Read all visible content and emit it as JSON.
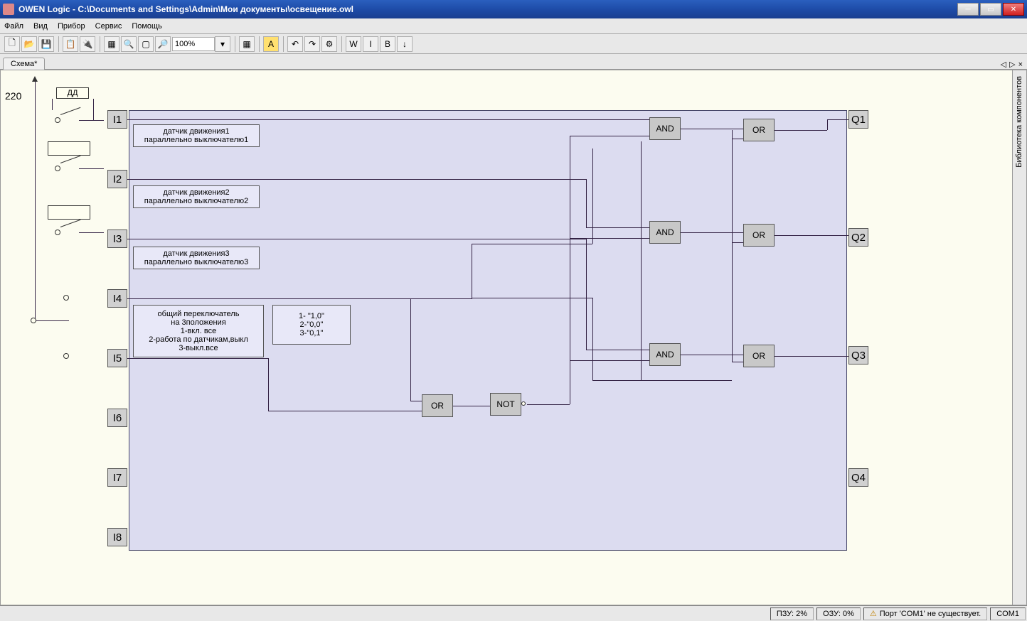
{
  "window": {
    "title": "OWEN Logic - C:\\Documents and Settings\\Admin\\Мои документы\\освещение.owl"
  },
  "menu": {
    "file": "Файл",
    "view": "Вид",
    "device": "Прибор",
    "service": "Сервис",
    "help": "Помощь"
  },
  "toolbar": {
    "zoom": "100%"
  },
  "tab": {
    "name": "Схема*"
  },
  "sidepanel": {
    "label": "Библиотека компонентов"
  },
  "status": {
    "rom": "ПЗУ: 2%",
    "ram": "ОЗУ: 0%",
    "port_msg": "Порт 'COM1' не существует.",
    "port": "COM1"
  },
  "diagram": {
    "voltage": "220",
    "dd": "ДД",
    "inputs": {
      "i1": "I1",
      "i2": "I2",
      "i3": "I3",
      "i4": "I4",
      "i5": "I5",
      "i6": "I6",
      "i7": "I7",
      "i8": "I8"
    },
    "outputs": {
      "q1": "Q1",
      "q2": "Q2",
      "q3": "Q3",
      "q4": "Q4"
    },
    "gates": {
      "and": "AND",
      "or": "OR",
      "not": "NOT"
    },
    "notes": {
      "n1a": "датчик движения1",
      "n1b": "параллельно выключателю1",
      "n2a": "датчик движения2",
      "n2b": "параллельно выключателю2",
      "n3a": "датчик движения3",
      "n3b": "параллельно выключателю3",
      "sw1": "общий переключатель",
      "sw2": "на 3положения",
      "sw3": "1-вкл. все",
      "sw4": "2-работа по датчикам,выкл",
      "sw5": "3-выкл.все",
      "code1": "1- \"1,0\"",
      "code2": "2-\"0,0\"",
      "code3": "3-\"0,1\""
    }
  }
}
